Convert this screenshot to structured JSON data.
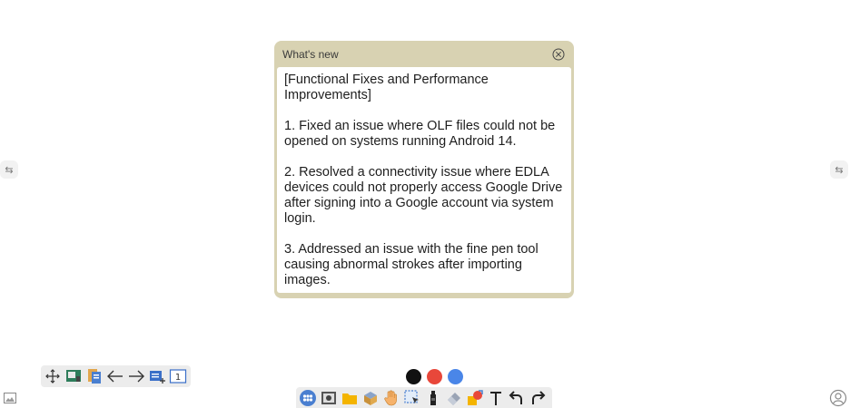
{
  "dialog": {
    "title": "What's new",
    "paragraphs": [
      "[Functional Fixes and Performance Improvements]",
      "1. Fixed an issue where OLF files could not be opened on systems running Android 14.",
      "2. Resolved a connectivity issue where EDLA devices could not properly access Google Drive after signing into a Google account via system login.",
      "3. Addressed an issue with the fine pen tool causing abnormal strokes after importing images."
    ]
  },
  "side_handles": {
    "left_glyph": "⇆",
    "right_glyph": "⇆"
  },
  "left_toolbar": {
    "icons": [
      "move-icon",
      "exit-board-icon",
      "pages-icon",
      "back-arrow-icon",
      "forward-arrow-icon",
      "add-page-icon",
      "page-number-icon"
    ],
    "page_number": "1"
  },
  "pen_colors": [
    "#111111",
    "#e8473a",
    "#4a86e8"
  ],
  "bottom_toolbar": {
    "icons": [
      "apps-icon",
      "camera-icon",
      "folder-icon",
      "box-icon",
      "hand-icon",
      "selection-icon",
      "marker-pen-icon",
      "eraser-icon",
      "shapes-icon",
      "text-icon",
      "undo-icon",
      "redo-icon"
    ]
  },
  "corner_icons": {
    "bottom_left": "image-icon",
    "bottom_right": "user-icon"
  }
}
